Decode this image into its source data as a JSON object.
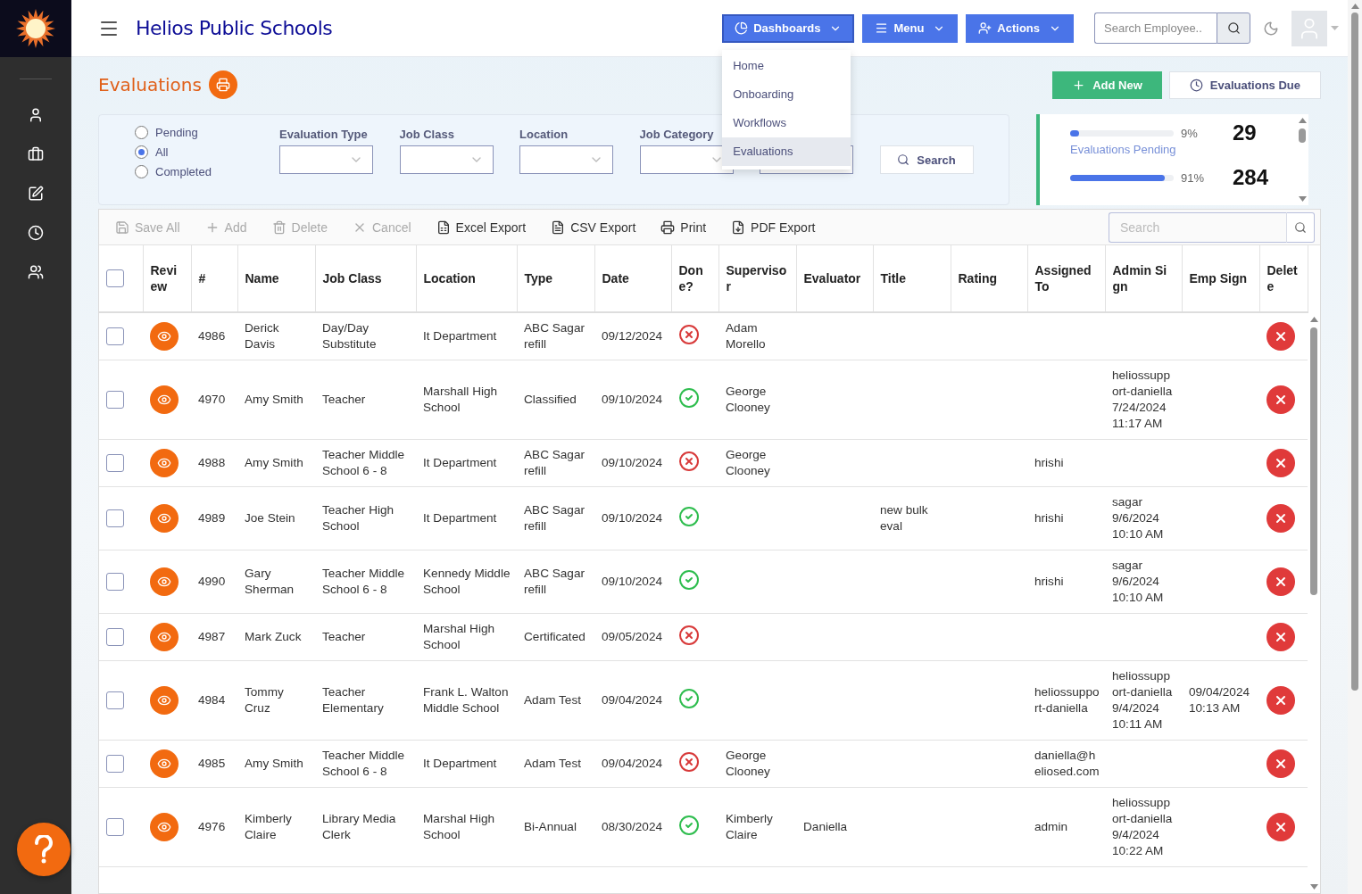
{
  "brand": {
    "title": "Helios Public Schools"
  },
  "nav_buttons": [
    {
      "label": "Dashboards",
      "expanded": true
    },
    {
      "label": "Menu",
      "expanded": false
    },
    {
      "label": "Actions",
      "expanded": false
    }
  ],
  "dashboards_menu": [
    {
      "label": "Home",
      "selected": false
    },
    {
      "label": "Onboarding",
      "selected": false
    },
    {
      "label": "Workflows",
      "selected": false
    },
    {
      "label": "Evaluations",
      "selected": true
    }
  ],
  "employee_search": {
    "placeholder": "Search Employee.."
  },
  "page_title": "Evaluations",
  "page_actions": [
    {
      "label": "Add New",
      "kind": "primary"
    },
    {
      "label": "Evaluations Due",
      "kind": "outline"
    }
  ],
  "filters": {
    "status_options": [
      {
        "label": "Pending",
        "selected": false
      },
      {
        "label": "All",
        "selected": true
      },
      {
        "label": "Completed",
        "selected": false
      }
    ],
    "selects": [
      {
        "kind": "labeled",
        "label": "Evaluation Type"
      },
      {
        "kind": "labeled",
        "label": "Job Class"
      },
      {
        "kind": "labeled",
        "label": "Location"
      },
      {
        "kind": "labeled",
        "label": "Job Category"
      },
      {
        "kind": "plain"
      }
    ],
    "search_button": "Search"
  },
  "stats": {
    "caption": "Evaluations Pending",
    "items": [
      {
        "percent": "9%",
        "level": 0.09,
        "count": "29"
      },
      {
        "percent": "91%",
        "level": 0.91,
        "count": "284"
      }
    ]
  },
  "toolbar": [
    {
      "label": "Save All",
      "disabled": true
    },
    {
      "label": "Add",
      "disabled": true
    },
    {
      "label": "Delete",
      "disabled": true
    },
    {
      "label": "Cancel",
      "disabled": true
    },
    {
      "label": "Excel Export",
      "disabled": false
    },
    {
      "label": "CSV Export",
      "disabled": false
    },
    {
      "label": "Print",
      "disabled": false
    },
    {
      "label": "PDF Export",
      "disabled": false
    }
  ],
  "grid_search": {
    "placeholder": "Search"
  },
  "table": {
    "header_checked": false,
    "columns": [
      "Review",
      "#",
      "Name",
      "Job Class",
      "Location",
      "Type",
      "Date",
      "Done?",
      "Supervisor",
      "Evaluator",
      "Title",
      "Rating",
      "Assigned To",
      "Admin Sign",
      "Emp Sign",
      "Delete"
    ],
    "rows": [
      {
        "checked": false,
        "number": "4986",
        "name": "Derick Davis",
        "job_class": "Day/Day Substitute",
        "location": "It Department",
        "type": "ABC Sagar refill",
        "date": "09/12/2024",
        "done": false,
        "supervisor": "Adam Morello"
      },
      {
        "checked": false,
        "number": "4970",
        "name": "Amy Smith",
        "job_class": "Teacher",
        "location": "Marshall High School",
        "type": "Classified",
        "date": "09/10/2024",
        "done": true,
        "supervisor": "George Clooney",
        "admin_sign": "heliossupport-daniella 7/24/2024 11:17 AM"
      },
      {
        "checked": false,
        "number": "4988",
        "name": "Amy Smith",
        "job_class": "Teacher Middle School 6 - 8",
        "location": "It Department",
        "type": "ABC Sagar refill",
        "date": "09/10/2024",
        "done": false,
        "supervisor": "George Clooney",
        "assigned_to": "hrishi"
      },
      {
        "checked": false,
        "number": "4989",
        "name": "Joe Stein",
        "job_class": "Teacher High School",
        "location": "It Department",
        "type": "ABC Sagar refill",
        "date": "09/10/2024",
        "done": true,
        "title": "new bulk eval",
        "assigned_to": "hrishi",
        "admin_sign": "sagar 9/6/2024 10:10 AM"
      },
      {
        "checked": false,
        "number": "4990",
        "name": "Gary Sherman",
        "job_class": "Teacher Middle School 6 - 8",
        "location": "Kennedy Middle School",
        "type": "ABC Sagar refill",
        "date": "09/10/2024",
        "done": true,
        "assigned_to": "hrishi",
        "admin_sign": "sagar 9/6/2024 10:10 AM"
      },
      {
        "checked": false,
        "number": "4987",
        "name": "Mark Zuck",
        "job_class": "Teacher",
        "location": "Marshal High School",
        "type": "Certificated",
        "date": "09/05/2024",
        "done": false
      },
      {
        "checked": false,
        "number": "4984",
        "name": "Tommy Cruz",
        "job_class": "Teacher Elementary",
        "location": "Frank L. Walton Middle School",
        "type": "Adam Test",
        "date": "09/04/2024",
        "done": true,
        "assigned_to": "heliossupport-daniella",
        "admin_sign": "heliossupport-daniella 9/4/2024 10:11 AM",
        "emp_sign": "09/04/2024 10:13 AM"
      },
      {
        "checked": false,
        "number": "4985",
        "name": "Amy Smith",
        "job_class": "Teacher Middle School 6 - 8",
        "location": "It Department",
        "type": "Adam Test",
        "date": "09/04/2024",
        "done": false,
        "supervisor": "George Clooney",
        "assigned_to": "daniella@heliosed.com"
      },
      {
        "checked": false,
        "number": "4976",
        "name": "Kimberly Claire",
        "job_class": "Library Media Clerk",
        "location": "Marshal High School",
        "type": "Bi-Annual",
        "date": "08/30/2024",
        "done": true,
        "supervisor": "Kimberly Claire",
        "evaluator": "Daniella",
        "assigned_to": "admin",
        "admin_sign": "heliossupport-daniella 9/4/2024 10:22 AM"
      }
    ]
  }
}
